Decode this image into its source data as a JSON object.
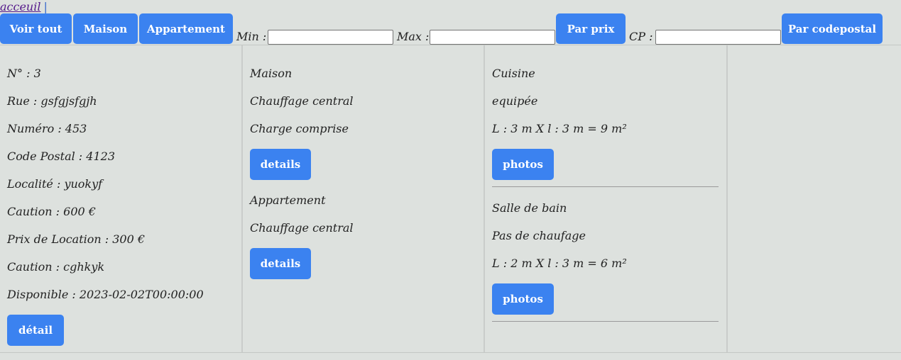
{
  "nav": {
    "home_link": "acceuil",
    "separator": "|"
  },
  "toolbar": {
    "show_all": "Voir tout",
    "house": "Maison",
    "apartment": "Appartement",
    "min_label": "Min :",
    "min_value": "",
    "max_label": "Max :",
    "max_value": "",
    "by_price": "Par prix",
    "cp_label": "CP :",
    "cp_value": "",
    "by_postcode": "Par codepostal"
  },
  "property": {
    "lines": [
      "N° : 3",
      "Rue : gsfgjsfgjh",
      "Numéro : 453",
      "Code Postal : 4123",
      "Localité : yuokyf",
      "Caution : 600 €",
      "Prix de Location : 300 €",
      "Caution : cghkyk",
      "Disponible : 2023-02-02T00:00:00"
    ],
    "detail_button": "détail"
  },
  "types": [
    {
      "lines": [
        "Maison",
        "Chauffage central",
        "Charge comprise"
      ],
      "button": "details"
    },
    {
      "lines": [
        "Appartement",
        "Chauffage central"
      ],
      "button": "details"
    }
  ],
  "rooms": [
    {
      "lines": [
        "Cuisine",
        "equipée",
        "L : 3 m X l : 3 m = 9 m²"
      ],
      "button": "photos"
    },
    {
      "lines": [
        "Salle de bain",
        "Pas de chaufage",
        "L : 2 m X l : 3 m = 6 m²"
      ],
      "button": "photos"
    }
  ],
  "colors": {
    "button": "#3b82f0",
    "background": "#dde1de"
  }
}
